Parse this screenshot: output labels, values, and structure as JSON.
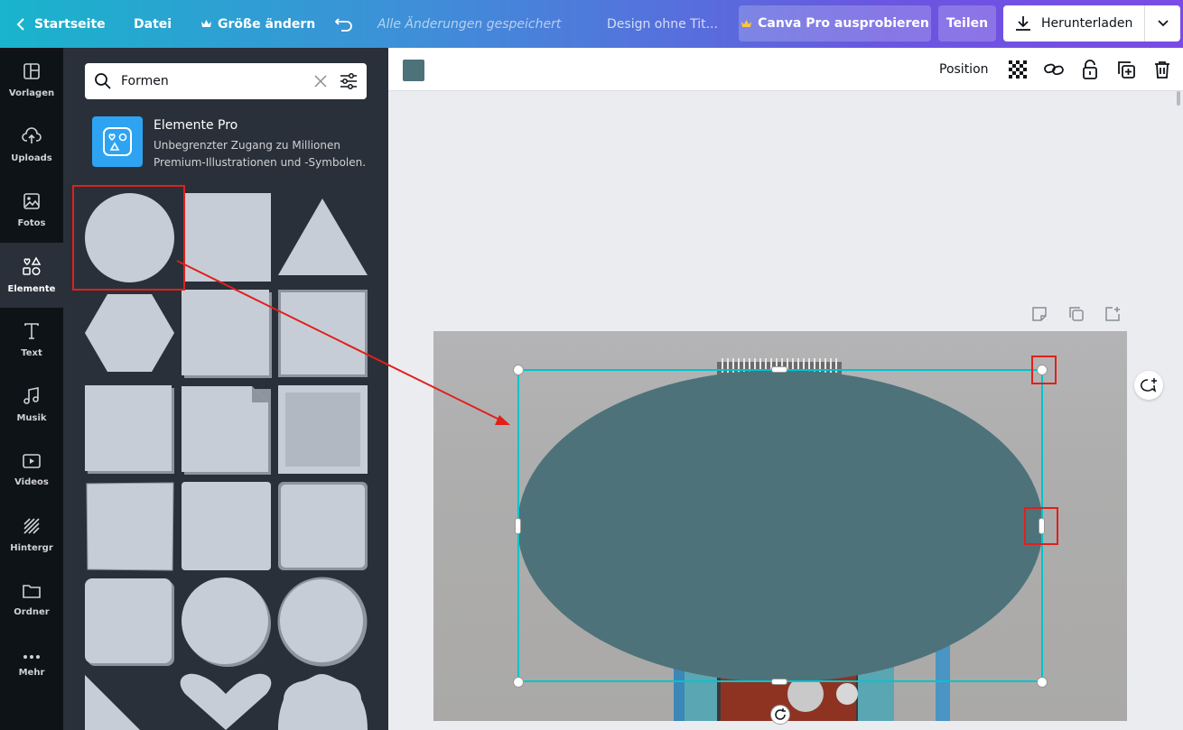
{
  "topbar": {
    "home": "Startseite",
    "file": "Datei",
    "resize": "Größe ändern",
    "saved_status": "Alle Änderungen gespeichert",
    "design_title": "Design ohne Tit...",
    "try_pro": "Canva Pro ausprobieren",
    "share": "Teilen",
    "download": "Herunterladen",
    "gradient_colors": [
      "#19b4cc",
      "#7a4be6"
    ]
  },
  "rail": {
    "items": [
      {
        "label": "Vorlagen",
        "icon": "layout-icon"
      },
      {
        "label": "Uploads",
        "icon": "cloud-upload-icon"
      },
      {
        "label": "Fotos",
        "icon": "image-icon"
      },
      {
        "label": "Elemente",
        "icon": "shapes-icon",
        "active": true
      },
      {
        "label": "Text",
        "icon": "text-icon"
      },
      {
        "label": "Musik",
        "icon": "music-icon"
      },
      {
        "label": "Videos",
        "icon": "video-icon"
      },
      {
        "label": "Hintergr",
        "icon": "background-icon"
      },
      {
        "label": "Ordner",
        "icon": "folder-icon"
      },
      {
        "label": "Mehr",
        "icon": "more-icon"
      }
    ]
  },
  "panel": {
    "search_value": "Formen",
    "promo_title": "Elemente Pro",
    "promo_desc_line1": "Unbegrenzter Zugang zu Millionen",
    "promo_desc_line2": "Premium-Illustrationen und -Symbolen."
  },
  "toolbar": {
    "fill_color": "#4d727a",
    "position": "Position"
  },
  "canvas": {
    "ellipse_color": "#4d727a",
    "selection_color": "#00c4cc",
    "annotation_color": "#e0201b"
  }
}
